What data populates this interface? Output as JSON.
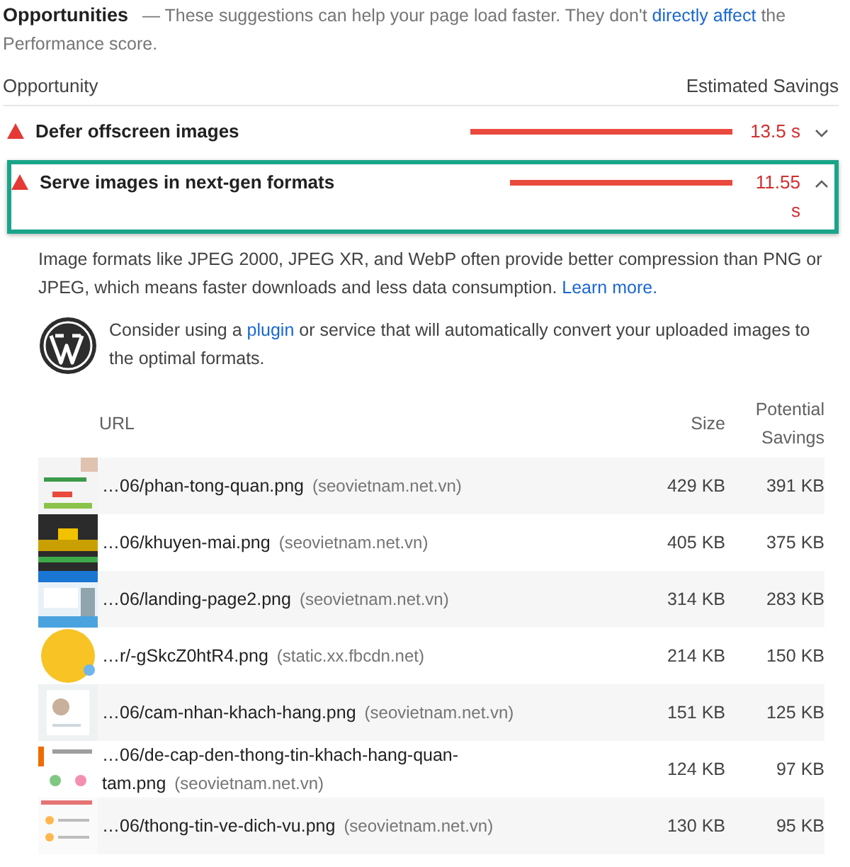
{
  "section": {
    "title": "Opportunities",
    "description": "— These suggestions can help your page load faster. They don't ",
    "link": "directly affect",
    "description_end": " the Performance score."
  },
  "columns": [
    "Opportunity",
    "Estimated Savings"
  ],
  "audits": [
    {
      "title": "Defer offscreen images",
      "savings": "13.5 s",
      "expanded": false,
      "highlighted": false
    },
    {
      "title": "Serve images in next-gen formats",
      "savings": "11.55 s",
      "expanded": true,
      "highlighted": true
    }
  ],
  "details": {
    "description": "Image formats like JPEG 2000, JPEG XR, and WebP often provide better compression than PNG or JPEG, which means faster downloads and less data consumption. ",
    "link": "Learn more.",
    "note_start": "Consider using a ",
    "note_link": "plugin",
    "note_end": " or service that will automatically convert your uploaded images to the optimal formats.",
    "columns": [
      "URL",
      "Size",
      "Potential Savings"
    ],
    "rows": [
      {
        "url": "…06/phan-tong-quan.png",
        "host": "(seovietnam.net.vn)",
        "size": "429 KB",
        "savings": "391 KB"
      },
      {
        "url": "…06/khuyen-mai.png",
        "host": "(seovietnam.net.vn)",
        "size": "405 KB",
        "savings": "375 KB"
      },
      {
        "url": "…06/landing-page2.png",
        "host": "(seovietnam.net.vn)",
        "size": "314 KB",
        "savings": "283 KB"
      },
      {
        "url": "…r/-gSkcZ0htR4.png",
        "host": "(static.xx.fbcdn.net)",
        "size": "214 KB",
        "savings": "150 KB"
      },
      {
        "url": "…06/cam-nhan-khach-hang.png",
        "host": "(seovietnam.net.vn)",
        "size": "151 KB",
        "savings": "125 KB"
      },
      {
        "url": "…06/de-cap-den-thong-tin-khach-hang-quan-tam.png",
        "host": "(seovietnam.net.vn)",
        "size": "124 KB",
        "savings": "97 KB"
      },
      {
        "url": "…06/thong-tin-ve-dich-vu.png",
        "host": "(seovietnam.net.vn)",
        "size": "130 KB",
        "savings": "95 KB"
      }
    ]
  }
}
